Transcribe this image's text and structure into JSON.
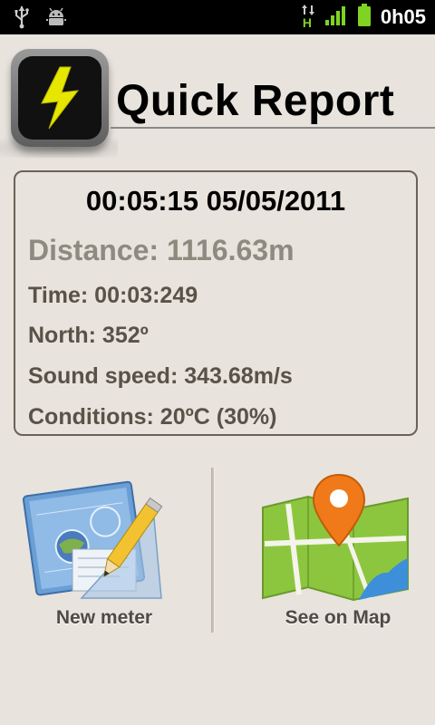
{
  "status_bar": {
    "time": "0h05",
    "network": "H",
    "icons": [
      "usb-icon",
      "android-debug-icon",
      "data-arrows-icon",
      "signal-icon",
      "battery-icon"
    ]
  },
  "header": {
    "title": "Quick Report",
    "logo_icon": "lightning-bolt-icon"
  },
  "report": {
    "timestamp": "00:05:15 05/05/2011",
    "distance": "Distance: 1116.63m",
    "time": "Time: 00:03:249",
    "north": "North: 352º",
    "sound_speed": "Sound speed: 343.68m/s",
    "conditions": "Conditions: 20ºC (30%)"
  },
  "actions": {
    "new_meter": {
      "label": "New meter",
      "icon": "blueprint-pencil-icon"
    },
    "see_on_map": {
      "label": "See on Map",
      "icon": "map-pin-icon"
    }
  },
  "colors": {
    "background": "#e8e3dd",
    "distance_text": "#8d8b7f",
    "row_text": "#5a5248",
    "bolt": "#e6e600"
  }
}
